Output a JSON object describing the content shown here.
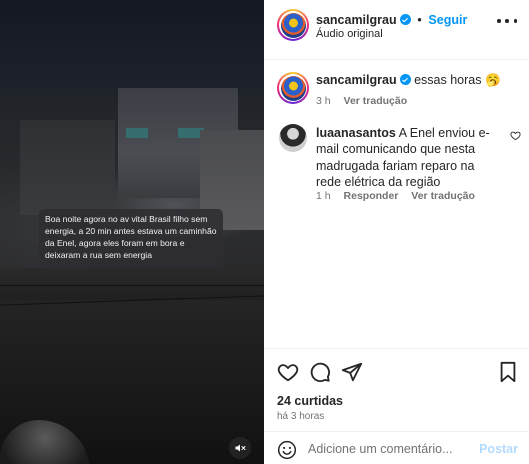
{
  "video": {
    "caption_text": "Boa noite agora no av vital Brasil filho sem energia, a 20 min antes estava um caminhão da Enel, agora eles foram em bora e deixaram a rua sem energia"
  },
  "header": {
    "username": "sancamilgrau",
    "separator": "•",
    "follow_label": "Seguir",
    "audio_label": "Áudio original"
  },
  "post_caption": {
    "username": "sancamilgrau",
    "text": "essas horas 🥱",
    "time": "3 h",
    "translate_label": "Ver tradução"
  },
  "comment": {
    "username": "luaanasantos",
    "text": "A Enel enviou e-mail comunicando que nesta madrugada fariam reparo na rede elétrica da região",
    "time": "1 h",
    "reply_label": "Responder",
    "translate_label": "Ver tradução"
  },
  "stats": {
    "likes": "24 curtidas",
    "posted": "há 3 horas"
  },
  "comment_box": {
    "placeholder": "Adicione um comentário...",
    "post_label": "Postar"
  },
  "colors": {
    "accent": "#0095f6",
    "verified": "#0095f6",
    "post_disabled": "#b3dbff"
  }
}
